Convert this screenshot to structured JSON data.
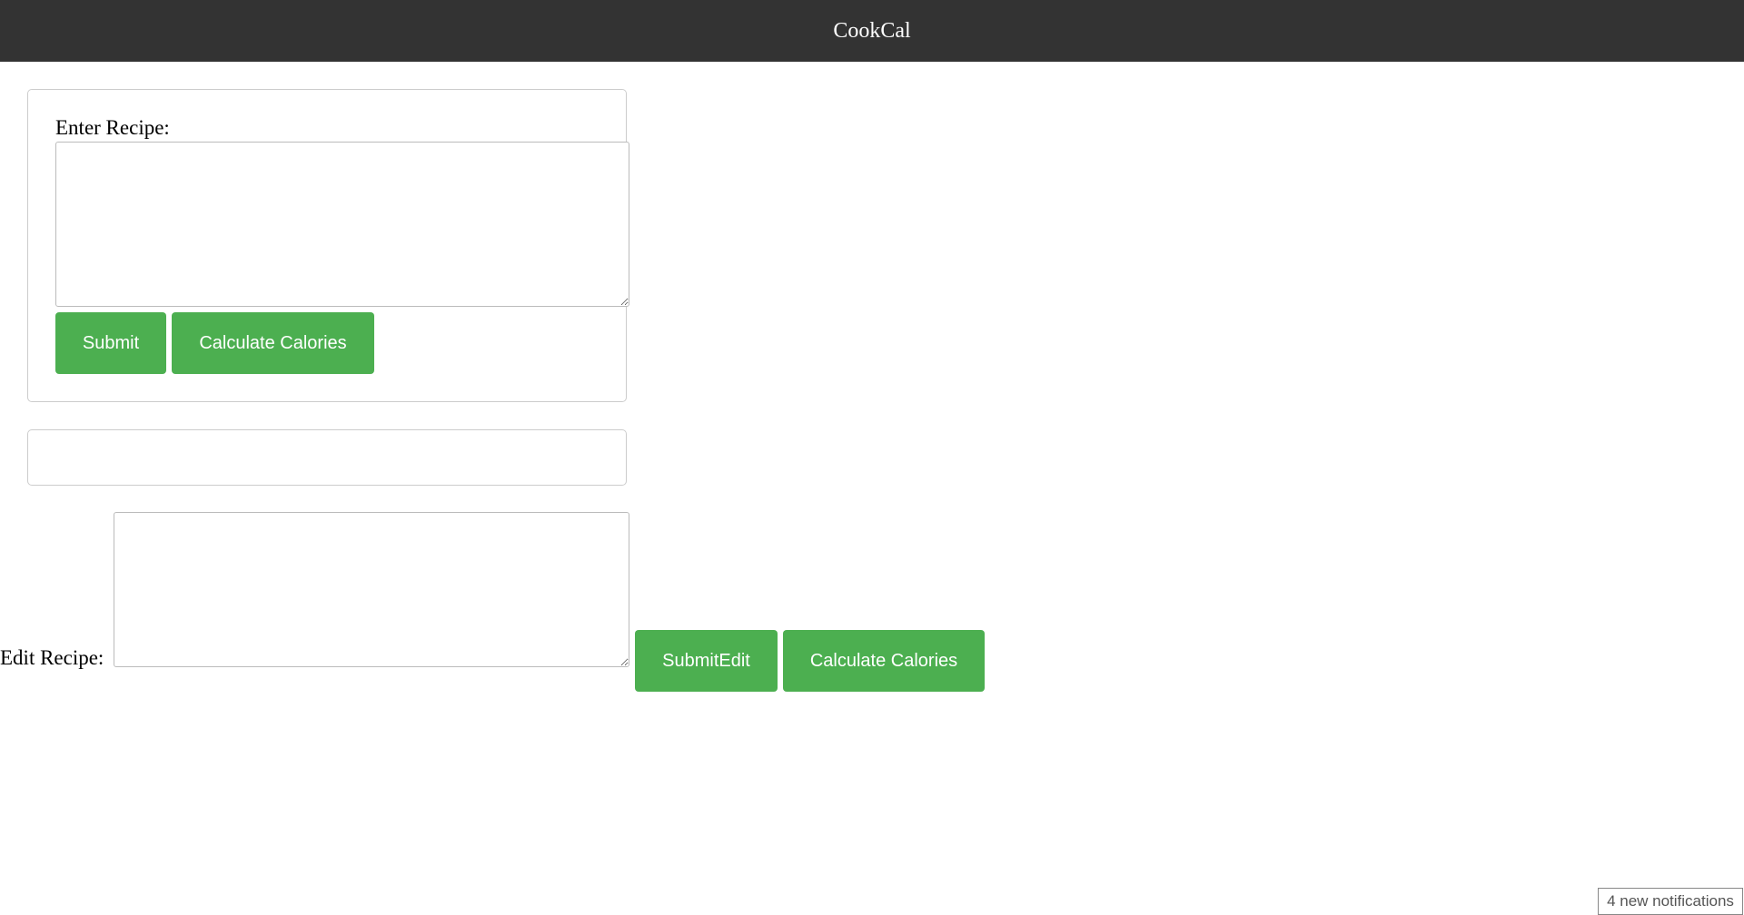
{
  "header": {
    "title": "CookCal"
  },
  "enter_form": {
    "label": "Enter Recipe:",
    "textarea_value": "",
    "submit_label": "Submit",
    "calc_label": "Calculate Calories"
  },
  "result": {
    "text": ""
  },
  "edit_form": {
    "label": "Edit Recipe:",
    "textarea_value": "",
    "submit_label": "SubmitEdit",
    "calc_label": "Calculate Calories"
  },
  "notifications": {
    "text": "4 new notifications"
  },
  "colors": {
    "header_bg": "#333333",
    "button_bg": "#4caf50",
    "button_text": "#ffffff"
  }
}
